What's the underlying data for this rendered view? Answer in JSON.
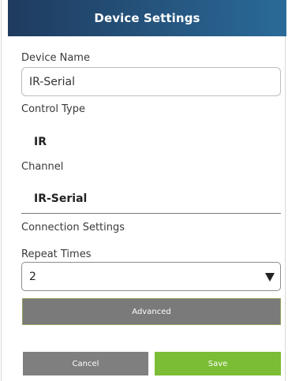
{
  "header": {
    "title": "Device Settings"
  },
  "device_name": {
    "label": "Device Name",
    "value": "IR-Serial"
  },
  "control_type": {
    "label": "Control Type",
    "value": "IR"
  },
  "channel": {
    "label": "Channel",
    "value": "IR-Serial"
  },
  "connection_settings": {
    "label": "Connection Settings"
  },
  "repeat_times": {
    "label": "Repeat Times",
    "selected": "2"
  },
  "buttons": {
    "advanced": "Advanced",
    "cancel": "Cancel",
    "save": "Save"
  },
  "colors": {
    "header_gradient_start": "#1f3b5f",
    "header_gradient_end": "#2a6a98",
    "advanced_button": "#7a7a7a",
    "cancel_button": "#7f7f7f",
    "save_button": "#7bbd35"
  },
  "icons": {
    "select_arrow": "triangle-down-icon"
  }
}
